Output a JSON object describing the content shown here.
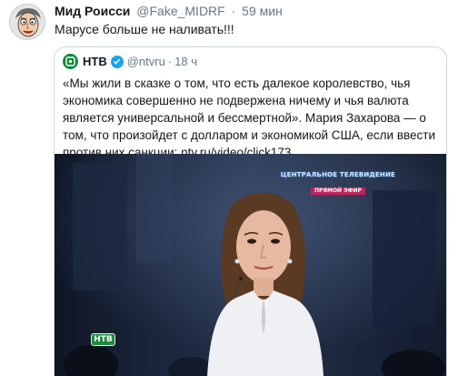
{
  "tweet": {
    "author_name": "Мид Роисси",
    "author_handle": "@Fake_MIDRF",
    "separator": "·",
    "time": "59 мин",
    "text": "Марусе больше не наливать!!!"
  },
  "quoted_tweet": {
    "author_name": "НТВ",
    "author_handle": "@ntvru",
    "separator": "·",
    "time": "18 ч",
    "text": "«Мы жили в сказке о том, что есть далекое королевство, чья экономика совершенно не подвержена ничему и чья валюта является универсальной и бессмертной». Мария Захарова — о том, что произойдет с долларом и экономикой США, если ввести против них санкции: ntv.ru/video/click173..."
  },
  "video_overlay": {
    "line1": "ЦЕНТРАЛЬНОЕ ТЕЛЕВИДЕНИЕ",
    "line2": "ПРЯМОЙ ЭФИР",
    "channel_bug": "НТВ"
  },
  "colors": {
    "text_primary": "#14171a",
    "text_secondary": "#657786",
    "border": "#ccd6dd",
    "verified_blue": "#1da1f2",
    "ntv_green": "#0c8a3e"
  }
}
